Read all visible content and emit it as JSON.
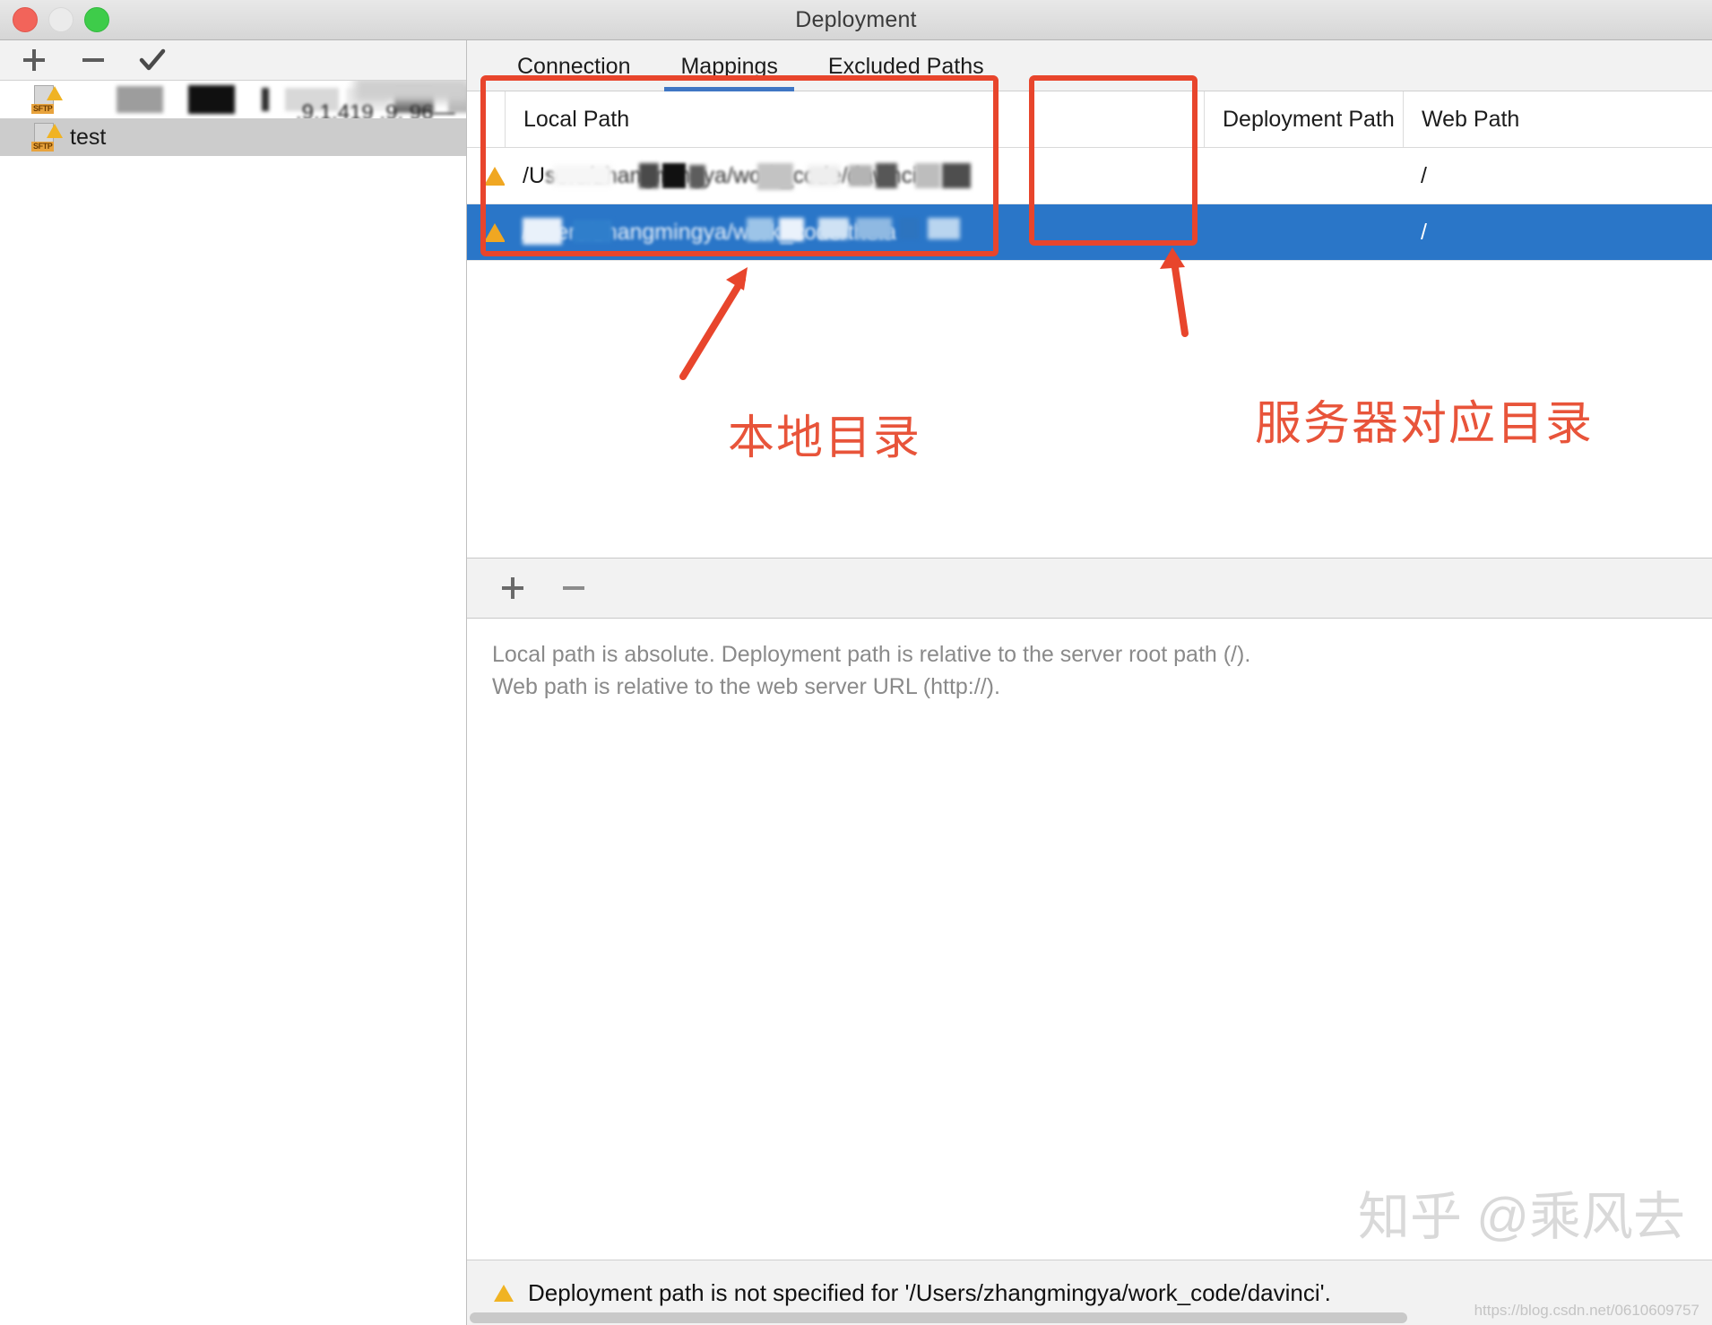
{
  "window": {
    "title": "Deployment",
    "traffic_lights": [
      "close",
      "minimize",
      "zoom"
    ]
  },
  "sidebar": {
    "toolbar": [
      {
        "name": "add",
        "glyph": "+"
      },
      {
        "name": "remove",
        "glyph": "−"
      },
      {
        "name": "set-default",
        "glyph": "✓"
      }
    ],
    "items": [
      {
        "label": "",
        "redacted": true,
        "icon": "sftp-warning-icon",
        "selected": false
      },
      {
        "label": "test",
        "redacted": false,
        "icon": "sftp-warning-icon",
        "selected": true
      }
    ]
  },
  "tabs": [
    {
      "label": "Connection",
      "active": false
    },
    {
      "label": "Mappings",
      "active": true
    },
    {
      "label": "Excluded Paths",
      "active": false
    }
  ],
  "mappings_table": {
    "columns": [
      "Local Path",
      "Deployment Path",
      "Web Path"
    ],
    "rows": [
      {
        "warning": true,
        "local_path": "/Users/zhangmingya/work_code/davinci",
        "local_path_redacted": true,
        "deployment_path": "",
        "web_path": "/",
        "selected": false
      },
      {
        "warning": true,
        "local_path": "/Users/zhangmingya/work_code/theia",
        "local_path_redacted": true,
        "deployment_path": "",
        "web_path": "/",
        "selected": true
      }
    ]
  },
  "table_toolbar": [
    {
      "name": "add-mapping",
      "glyph": "+"
    },
    {
      "name": "remove-mapping",
      "glyph": "−"
    }
  ],
  "help": {
    "line1": "Local path is absolute. Deployment path is relative to the server root path (/).",
    "line2": "Web path is relative to the web server URL (http://)."
  },
  "status": {
    "icon": "warning-icon",
    "message": "Deployment path is not specified for '/Users/zhangmingya/work_code/davinci'."
  },
  "annotations": [
    {
      "name": "local-path-callout",
      "text": "本地目录"
    },
    {
      "name": "deployment-path-callout",
      "text": "服务器对应目录"
    }
  ],
  "watermarks": {
    "zhihu": "知乎 @乘风去",
    "csdn": "https://blog.csdn.net/0610609757"
  },
  "colors": {
    "annotation_red": "#e8452c",
    "selection_blue": "#2a76c8",
    "tab_indicator": "#3f76c4",
    "warning_amber": "#f0b323"
  }
}
